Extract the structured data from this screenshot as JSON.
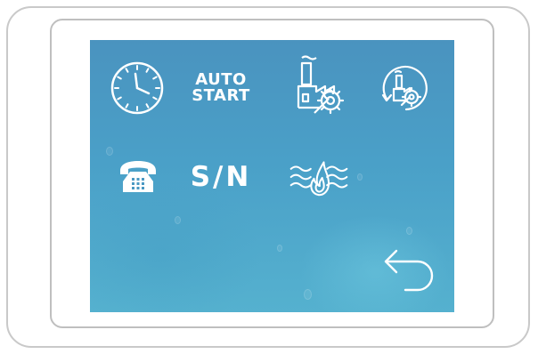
{
  "device": {
    "screen": {
      "tiles": {
        "clock": {
          "icon": "clock-icon"
        },
        "auto_start": {
          "line1": "AUTO",
          "line2": "START"
        },
        "factory_service": {
          "icon": "factory-service-icon"
        },
        "factory_cycle": {
          "icon": "factory-cycle-icon"
        },
        "phone": {
          "icon": "phone-icon"
        },
        "serial_number": {
          "label": "S/N"
        },
        "burner": {
          "icon": "flame-airflow-icon"
        },
        "back": {
          "icon": "back-arrow-icon"
        }
      }
    }
  },
  "colors": {
    "screen_top": "#4a93bf",
    "screen_bottom": "#55b1cf",
    "icon": "#ffffff",
    "frame": "#c9c9c9"
  }
}
